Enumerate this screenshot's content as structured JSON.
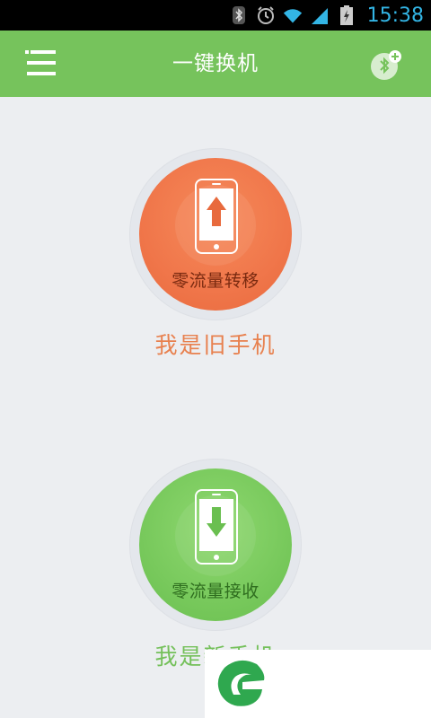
{
  "status_bar": {
    "time": "15:38",
    "icons": [
      "bluetooth-icon",
      "alarm-icon",
      "wifi-icon",
      "signal-icon",
      "battery-charging-icon"
    ],
    "accent": "#33b5e5"
  },
  "app_bar": {
    "title": "一键换机",
    "background": "#76c35c",
    "left_icon": "menu-icon",
    "right_icon": "bluetooth-add-icon"
  },
  "old_phone": {
    "button_label": "零流量转移",
    "caption": "我是旧手机",
    "icon": "phone-upload-icon",
    "color": "#f0764a"
  },
  "new_phone": {
    "button_label": "零流量接收",
    "caption": "我是新手机",
    "icon": "phone-download-icon",
    "color": "#78c95c"
  },
  "overlay": {
    "logo": "app-logo-icon",
    "logo_color": "#2fa84f"
  }
}
